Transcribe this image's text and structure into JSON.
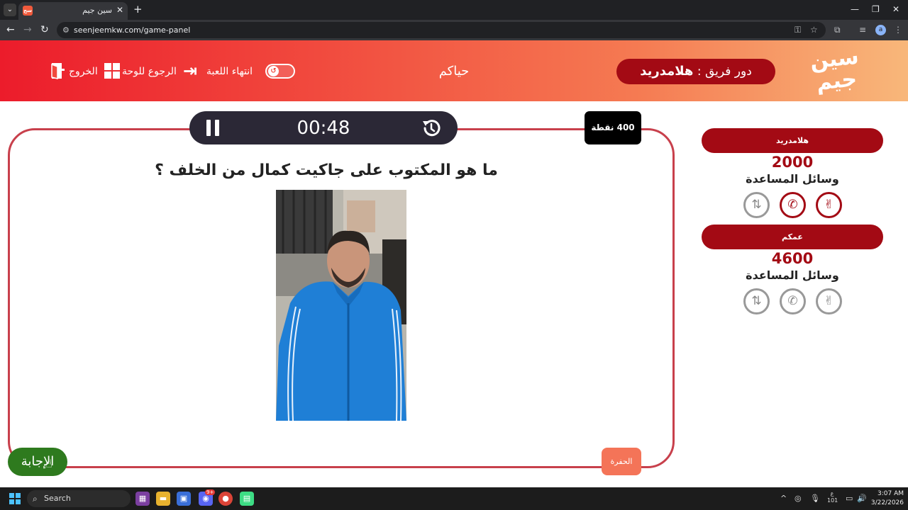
{
  "browser": {
    "tab_title": "سين جيم",
    "tab_favicon_text": "سين جيم",
    "url": "seenjeemkw.com/game-panel",
    "profile_initial": "a"
  },
  "header": {
    "logo_text": "سين جيم",
    "turn_prefix": "دور فريق :",
    "turn_team": "هلامدريد",
    "greeting": "حياكم",
    "end_game_label": "انتهاء اللعبة",
    "back_to_board_label": "الرجوع للوحة",
    "exit_label": "الخروج"
  },
  "game": {
    "timer": "00:48",
    "points": "400 نقطة",
    "question": "ما هو المكتوب على جاكيت كمال من الخلف ؟",
    "pit_label": "الحفرة",
    "answer_label": "الإجابة"
  },
  "teams": [
    {
      "name": "هلامدريد",
      "score": "2000",
      "aids_label": "وسائل المساعدة",
      "aids_active": [
        true,
        true,
        false
      ]
    },
    {
      "name": "عمكم",
      "score": "4600",
      "aids_label": "وسائل المساعدة",
      "aids_active": [
        false,
        false,
        false
      ]
    }
  ],
  "taskbar": {
    "search_placeholder": "Search",
    "time": "3:07 AM",
    "date": "3/22/2026",
    "lang_line1": "ع",
    "lang_line2": "101",
    "discord_badge": "9+"
  },
  "colors": {
    "header_gradient_start": "#ec1c2b",
    "header_gradient_end": "#f8b77a",
    "team_pill": "#a30a14",
    "panel_border": "#c8404c",
    "timer_bg": "#2b2836",
    "answer_button": "#2e7a1e",
    "pit_button": "#f47458"
  },
  "icons": [
    "pause-icon",
    "reset-timer-icon",
    "grid-icon",
    "enter-icon",
    "exit-door-icon",
    "peace-hand-icon",
    "phone-icon",
    "swap-icon"
  ]
}
